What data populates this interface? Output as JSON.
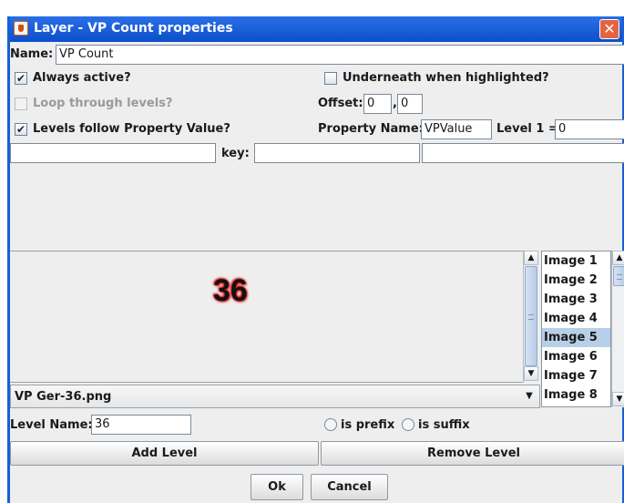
{
  "window": {
    "title": "Layer - VP Count properties",
    "close_glyph": "✕"
  },
  "name": {
    "label": "Name:",
    "value": "VP Count"
  },
  "always_active": {
    "label": "Always active?",
    "checked": true,
    "check_glyph": "✔"
  },
  "underneath": {
    "label": "Underneath when highlighted?",
    "checked": false
  },
  "loop_levels": {
    "label": "Loop through levels?",
    "checked": false,
    "enabled": false
  },
  "offset": {
    "label": "Offset:",
    "x": "0",
    "separator": ",",
    "y": "0"
  },
  "levels_follow": {
    "label": "Levels follow Property Value?",
    "checked": true,
    "check_glyph": "✔"
  },
  "property_name": {
    "label": "Property Name:",
    "value": "VPValue"
  },
  "level1": {
    "label": "Level 1 =",
    "value": "0"
  },
  "key": {
    "label": "key:",
    "value": ""
  },
  "preview": {
    "text": "36"
  },
  "image_list": {
    "items": [
      "Image 1",
      "Image 2",
      "Image 3",
      "Image 4",
      "Image 5",
      "Image 6",
      "Image 7",
      "Image 8"
    ],
    "selected": "Image 5"
  },
  "image_combo": {
    "value": "VP Ger-36.png",
    "arrow": "▼"
  },
  "level_name": {
    "label": "Level Name:",
    "value": "36"
  },
  "affix": {
    "prefix_label": "is prefix",
    "suffix_label": "is suffix"
  },
  "buttons": {
    "add_level": "Add Level",
    "remove_level": "Remove Level",
    "ok": "Ok",
    "cancel": "Cancel"
  },
  "scroll": {
    "up": "▲",
    "down": "▼"
  },
  "colors": {
    "title_bar": "#0c4fc9",
    "selection": "#b8cfe8",
    "close": "#e3643e",
    "number_glow": "#e01010"
  }
}
